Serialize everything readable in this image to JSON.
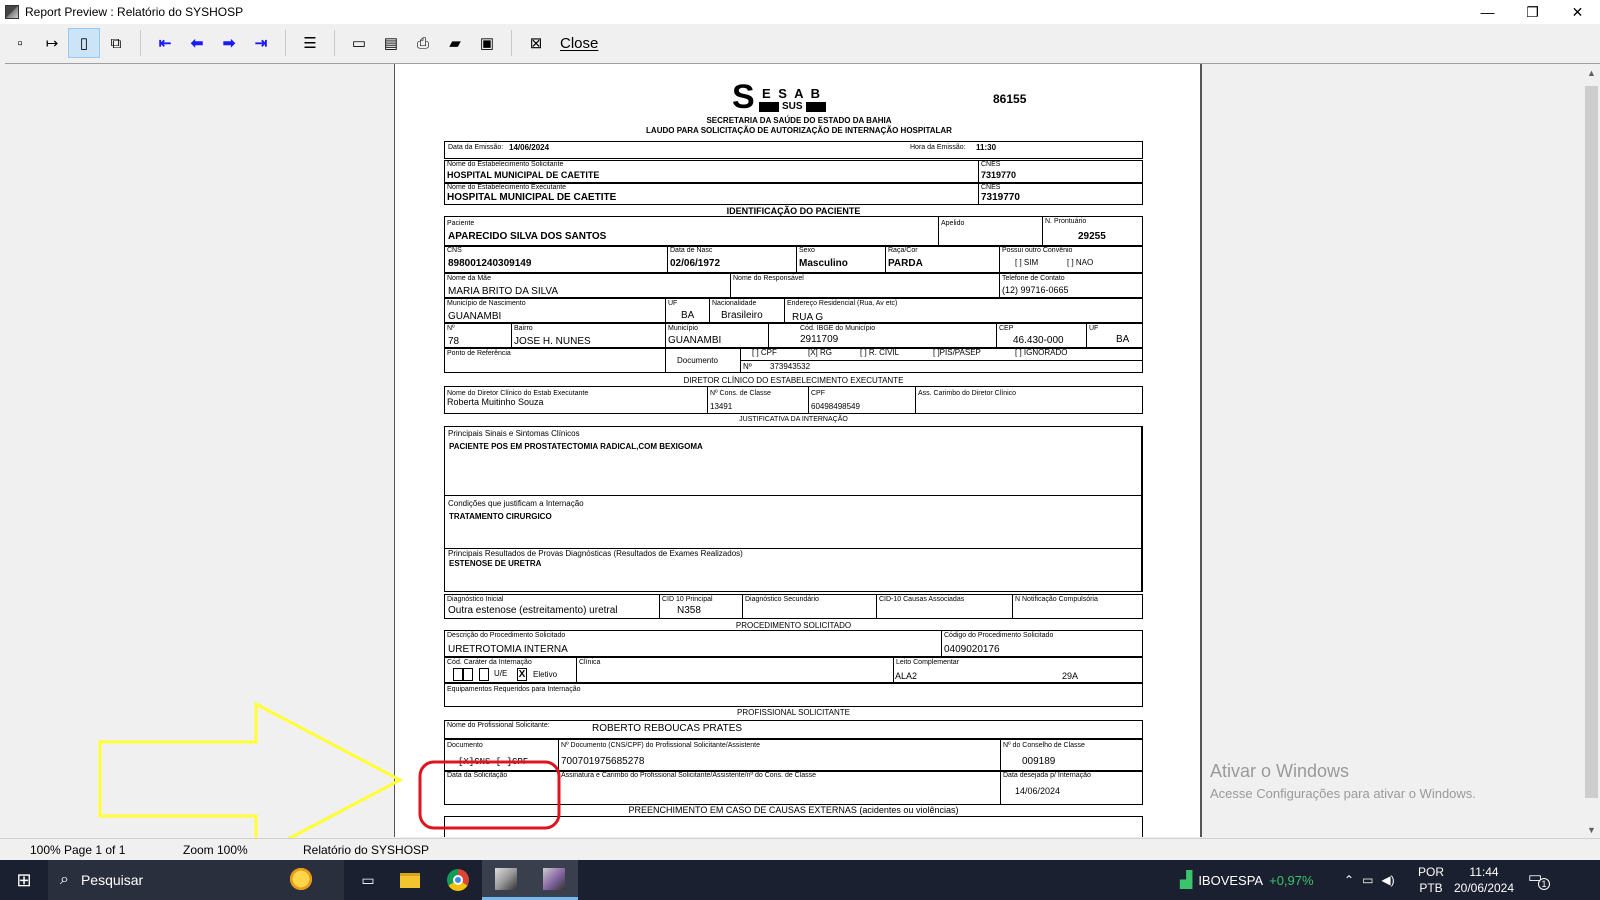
{
  "window": {
    "title": "Report Preview : Relatório do SYSHOSP",
    "minimize": "—",
    "restore": "❐",
    "close": "✕"
  },
  "toolbar": {
    "close_label": "Close"
  },
  "report": {
    "logo_s": "S",
    "logo_esab": "E S A B",
    "logo_sus": "SUS",
    "number": "86155",
    "secretaria": "SECRETARIA DA SAÚDE DO ESTADO DA BAHIA",
    "laudo": "LAUDO PARA SOLICITAÇÃO DE AUTORIZAÇÃO DE INTERNAÇÃO HOSPITALAR",
    "data_emissao_label": "Data da Emissão:",
    "data_emissao": "14/06/2024",
    "hora_emissao_label": "Hora da Emissão:",
    "hora_emissao": "11:30",
    "estab_solic_label": "Nome do Estabelecimento Solicitante",
    "estab_solic": "HOSPITAL MUNICIPAL DE CAETITE",
    "cnes_label": "CNES",
    "cnes1": "7319770",
    "estab_exec_label": "Nome do Estabelecimento Executante",
    "estab_exec": "HOSPITAL MUNICIPAL DE CAETITE",
    "cnes2": "7319770",
    "sec_paciente": "IDENTIFICAÇÃO DO PACIENTE",
    "paciente_label": "Paciente",
    "paciente": "APARECIDO SILVA DOS SANTOS",
    "apelido_label": "Apelido",
    "prontuario_label": "N. Prontuário",
    "prontuario": "29255",
    "cns_label": "CNS",
    "cns": "898001240309149",
    "nasc_label": "Data de Nasc",
    "nasc": "02/06/1972",
    "sexo_label": "Sexo",
    "sexo": "Masculino",
    "raca_label": "Raça/Cor",
    "raca": "PARDA",
    "convenio_label": "Possui outro Convênio",
    "convenio_sim": "[    ] SIM",
    "convenio_nao": "[    ] NAO",
    "mae_label": "Nome da Mãe",
    "mae": "MARIA BRITO DA SILVA",
    "responsavel_label": "Nome do Responsável",
    "telefone_label": "Telefone de Contato",
    "telefone": "(12) 99716-0665",
    "mun_nasc_label": "Município de Nascimento",
    "mun_nasc": "GUANAMBI",
    "uf_label": "UF",
    "uf_nasc": "BA",
    "nacionalidade_label": "Nacionalidade",
    "nacionalidade": "Brasileiro",
    "endereco_label": "Endereço Residencial (Rua, Av etc)",
    "endereco": "RUA G",
    "num_label": "Nº",
    "num": "78",
    "bairro_label": "Bairro",
    "bairro": "JOSE H. NUNES",
    "municipio_label": "Município",
    "municipio": "GUANAMBI",
    "ibge_label": "Cód. IBGE do Município",
    "ibge": "2911709",
    "cep_label": "CEP",
    "cep": "46.430-000",
    "uf2": "BA",
    "referencia_label": "Ponto de Referência",
    "documento_label": "Documento",
    "doc_cpf": "[    ] CPF",
    "doc_rg": "[X] RG",
    "doc_rcivil": "[    ] R. CIVIL",
    "doc_pis": "[    ]PIS/PASEP",
    "doc_ignorado": "[    ] IGNORADO",
    "doc_num_label": "Nº",
    "doc_num": "373943532",
    "sec_diretor": "DIRETOR CLÍNICO DO ESTABELECIMENTO EXECUTANTE",
    "diretor_label": "Nome do Diretor Clínico do Estab Executante",
    "diretor": "Roberta Muitinho Souza",
    "cons_classe_label": "Nº Cons. de Classe",
    "cons_classe": "13491",
    "cpf_label": "CPF",
    "cpf": "60498498549",
    "carimbo_label": "Ass. Carimbo do Diretor Clínico",
    "sec_justificativa": "JUSTIFICATIVA DA INTERNAÇÃO",
    "sinais_label": "Principais Sinais e Sintomas Clínicos",
    "sinais": "PACIENTE POS EM PROSTATECTOMIA RADICAL,COM BEXIGOMA",
    "condicoes_label": "Condições que justificam a Internação",
    "condicoes": "TRATAMENTO CIRURGICO",
    "resultados_label": "Principais Resultados de Provas Diagnósticas (Resultados de Exames Realizados)",
    "resultados": "ESTENOSE DE URETRA",
    "diag_inicial_label": "Diagnóstico Inicial",
    "diag_inicial": "Outra estenose (estreitamento) uretral",
    "cid_label": "CID 10 Principal",
    "cid": "N358",
    "diag_sec_label": "Diagnóstico Secundário",
    "cid_causas_label": "CID-10 Causas Associadas",
    "notif_label": "N Notificação Compulsória",
    "sec_procedimento": "PROCEDIMENTO SOLICITADO",
    "proc_desc_label": "Descrição do Procedimento Solicitado",
    "proc_desc": "URETROTOMIA INTERNA",
    "proc_cod_label": "Código do Procedimento Solicitado",
    "proc_cod": "0409020176",
    "carater_label": "Cód. Caráter da Internação",
    "carater_ue": "U/E",
    "carater_x": "X",
    "carater_eletivo": "Eletivo",
    "clinica_label": "Clínica",
    "leito_label": "Leito Complementar",
    "leito": "ALA2",
    "leito_num": "29A",
    "equip_label": "Equipamentos Requeridos para Internação",
    "sec_profissional": "PROFISSIONAL SOLICITANTE",
    "prof_nome_label": "Nome do Profissional Solicitante:",
    "prof_nome": "ROBERTO REBOUCAS PRATES",
    "prof_doc_label": "Documento",
    "prof_doc_opts": "[X]CNS [ ]CPF",
    "prof_docnum_label": "Nº Documento (CNS/CPF) do Profissional Solicitante/Assistente",
    "prof_docnum": "700701975685278",
    "conselho_label": "Nº do Conselho de Classe",
    "conselho": "009189",
    "data_solic_label": "Data da Solicitação",
    "assinatura_label": "Assinatura e Carimbo do Profissional Solicitante/Assistente/nº do Cons. de Classe",
    "data_desejada_label": "Data desejada p/ Internação",
    "data_desejada": "14/06/2024",
    "sec_externas": "PREENCHIMENTO EM CASO DE CAUSAS EXTERNAS (acidentes ou violências)"
  },
  "watermark": {
    "title": "Ativar o Windows",
    "subtitle": "Acesse Configurações para ativar o Windows."
  },
  "statusbar": {
    "zoom_pct": "100%",
    "page": "Page 1 of 1",
    "zoom": "Zoom 100%",
    "report_name": "Relatório do SYSHOSP"
  },
  "taskbar": {
    "search_placeholder": "Pesquisar",
    "stock_name": "IBOVESPA",
    "stock_change": "+0,97%",
    "lang1": "POR",
    "lang2": "PTB",
    "time": "11:44",
    "date": "20/06/2024",
    "notification_count": "1"
  },
  "colors": {
    "stock_up": "#3cc46a",
    "highlight_arrow": "#ffff33",
    "annotation_circle": "#e0141e",
    "toolbar_nav": "#1a1aff"
  }
}
